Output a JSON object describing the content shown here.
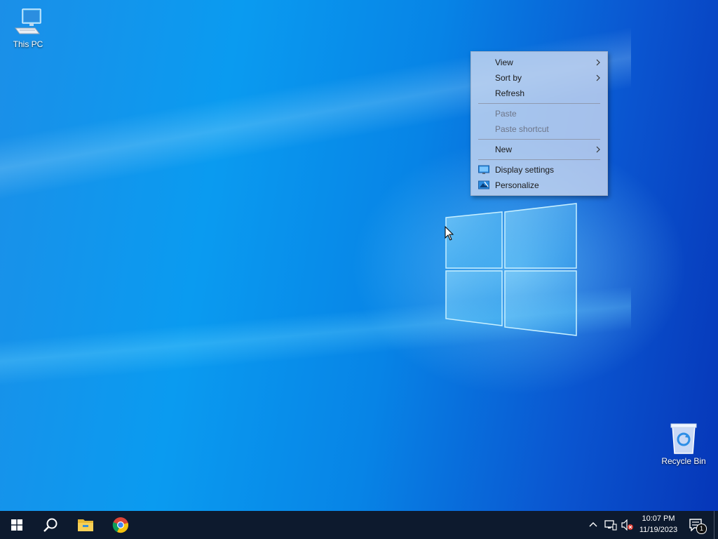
{
  "desktop": {
    "icons": [
      {
        "label": "This PC",
        "icon": "computer-icon"
      },
      {
        "label": "Recycle Bin",
        "icon": "recycle-bin-icon"
      }
    ]
  },
  "context_menu": {
    "items": [
      {
        "label": "View",
        "enabled": true,
        "submenu": true
      },
      {
        "label": "Sort by",
        "enabled": true,
        "submenu": true
      },
      {
        "label": "Refresh",
        "enabled": true,
        "submenu": false
      },
      {
        "label": "Paste",
        "enabled": false,
        "submenu": false
      },
      {
        "label": "Paste shortcut",
        "enabled": false,
        "submenu": false
      },
      {
        "label": "New",
        "enabled": true,
        "submenu": true
      },
      {
        "label": "Display settings",
        "enabled": true,
        "submenu": false,
        "icon": "display-settings-icon"
      },
      {
        "label": "Personalize",
        "enabled": true,
        "submenu": false,
        "icon": "personalize-icon"
      }
    ]
  },
  "taskbar": {
    "pinned": [
      "start-icon",
      "search-icon",
      "file-explorer-icon",
      "chrome-icon"
    ],
    "tray_icons": [
      "chevron-up-icon",
      "network-icon",
      "volume-muted-icon"
    ],
    "clock": {
      "time": "10:07 PM",
      "date": "11/19/2023"
    },
    "notifications": {
      "count": "1"
    }
  },
  "colors": {
    "accent": "#0a78e0",
    "taskbar": "#0d1a2e",
    "menu_bg": "#c8d7f0"
  }
}
